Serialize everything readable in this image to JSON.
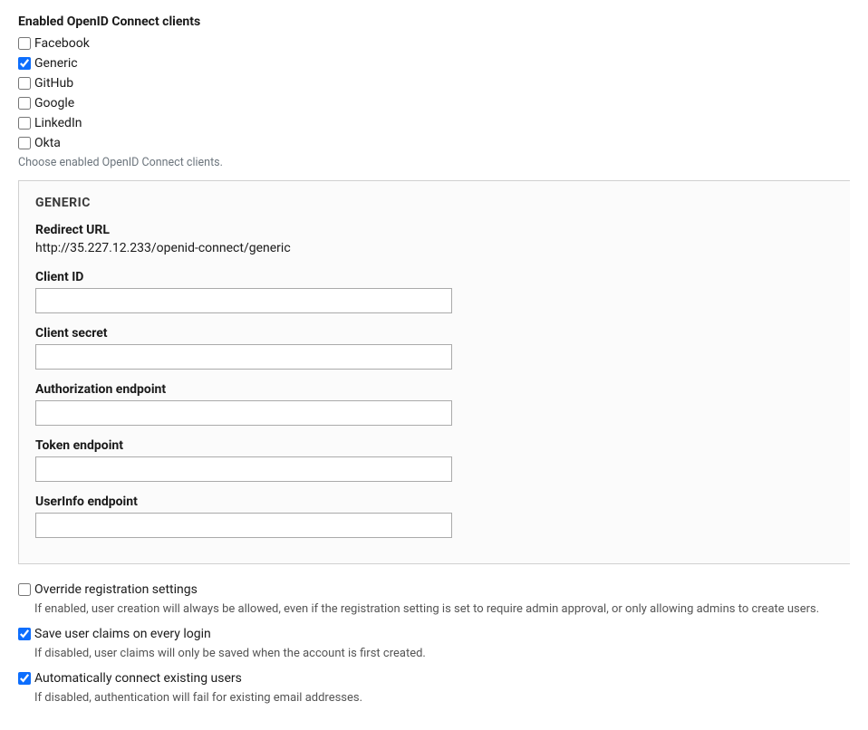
{
  "heading": "Enabled OpenID Connect clients",
  "clients": [
    {
      "id": "facebook",
      "label": "Facebook",
      "checked": false
    },
    {
      "id": "generic",
      "label": "Generic",
      "checked": true
    },
    {
      "id": "github",
      "label": "GitHub",
      "checked": false
    },
    {
      "id": "google",
      "label": "Google",
      "checked": false
    },
    {
      "id": "linkedin",
      "label": "LinkedIn",
      "checked": false
    },
    {
      "id": "okta",
      "label": "Okta",
      "checked": false
    }
  ],
  "clients_help": "Choose enabled OpenID Connect clients.",
  "panel": {
    "title": "GENERIC",
    "redirect_label": "Redirect URL",
    "redirect_value": "http://35.227.12.233/openid-connect/generic",
    "client_id_label": "Client ID",
    "client_id_value": "",
    "client_secret_label": "Client secret",
    "client_secret_value": "",
    "auth_endpoint_label": "Authorization endpoint",
    "auth_endpoint_value": "",
    "token_endpoint_label": "Token endpoint",
    "token_endpoint_value": "",
    "userinfo_endpoint_label": "UserInfo endpoint",
    "userinfo_endpoint_value": ""
  },
  "options": {
    "override_label": "Override registration settings",
    "override_checked": false,
    "override_help": "If enabled, user creation will always be allowed, even if the registration setting is set to require admin approval, or only allowing admins to create users.",
    "save_claims_label": "Save user claims on every login",
    "save_claims_checked": true,
    "save_claims_help": "If disabled, user claims will only be saved when the account is first created.",
    "auto_connect_label": "Automatically connect existing users",
    "auto_connect_checked": true,
    "auto_connect_help": "If disabled, authentication will fail for existing email addresses."
  }
}
